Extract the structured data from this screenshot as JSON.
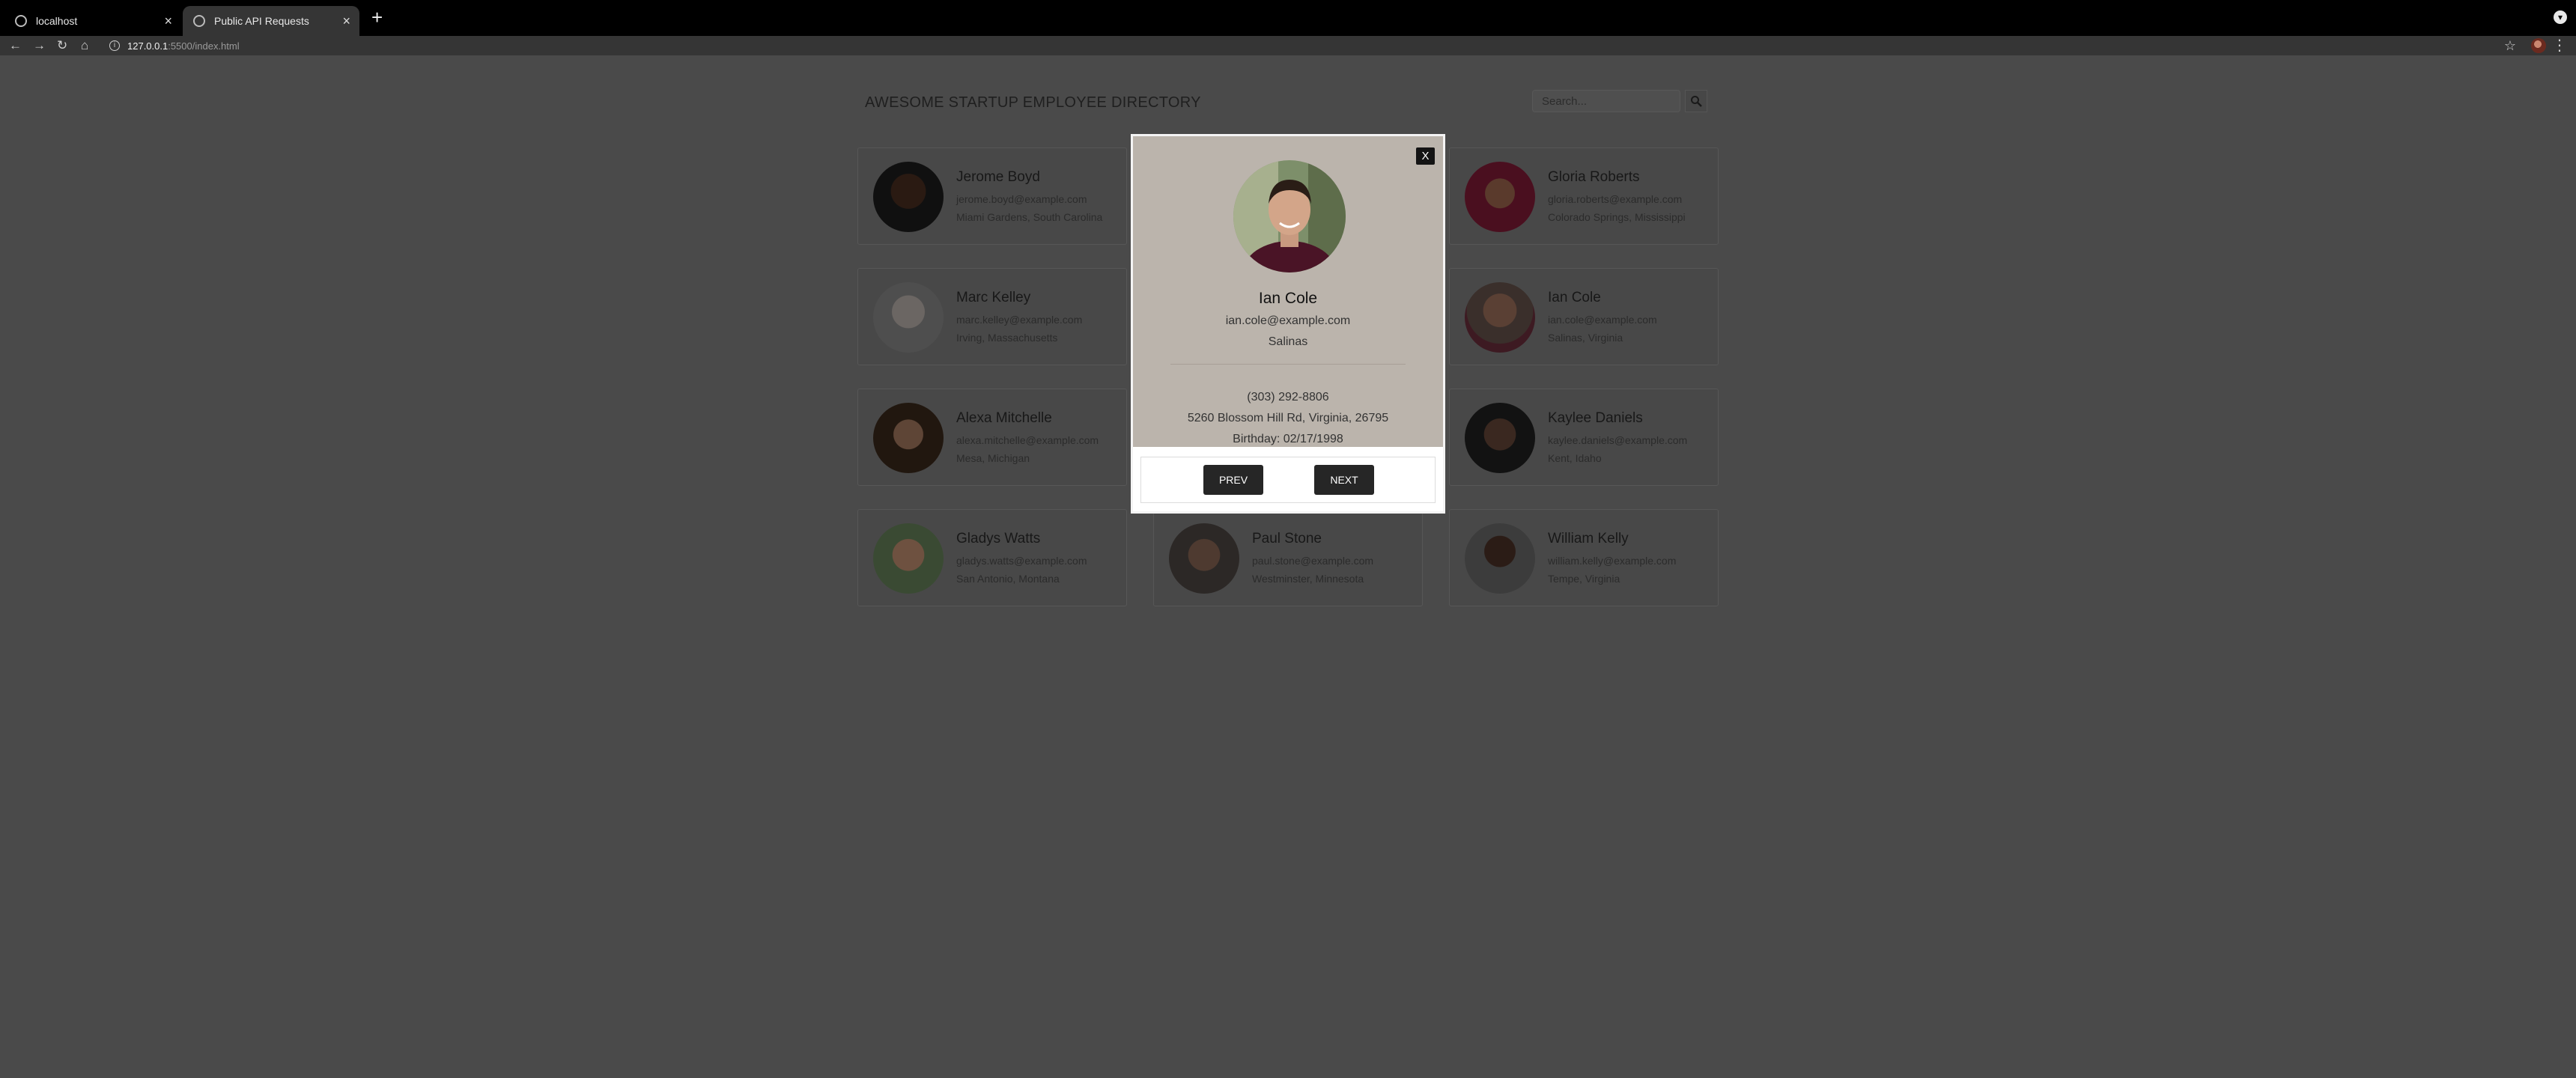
{
  "browser": {
    "tabs": [
      {
        "title": "localhost"
      },
      {
        "title": "Public API Requests"
      }
    ],
    "url_host": "127.0.0.1",
    "url_path": ":5500/index.html"
  },
  "page": {
    "title": "AWESOME STARTUP EMPLOYEE DIRECTORY",
    "search_placeholder": "Search..."
  },
  "employees": [
    {
      "name": "Jerome Boyd",
      "email": "jerome.boyd@example.com",
      "location": "Miami Gardens, South Carolina"
    },
    {
      "name": "Gloria Roberts",
      "email": "gloria.roberts@example.com",
      "location": "Colorado Springs, Mississippi"
    },
    {
      "name": "Marc Kelley",
      "email": "marc.kelley@example.com",
      "location": "Irving, Massachusetts"
    },
    {
      "name": "Ian Cole",
      "email": "ian.cole@example.com",
      "location": "Salinas, Virginia"
    },
    {
      "name": "Alexa Mitchelle",
      "email": "alexa.mitchelle@example.com",
      "location": "Mesa, Michigan"
    },
    {
      "name": "Kaylee Daniels",
      "email": "kaylee.daniels@example.com",
      "location": "Kent, Idaho"
    },
    {
      "name": "Gladys Watts",
      "email": "gladys.watts@example.com",
      "location": "San Antonio, Montana"
    },
    {
      "name": "Paul Stone",
      "email": "paul.stone@example.com",
      "location": "Westminster, Minnesota"
    },
    {
      "name": "William Kelly",
      "email": "william.kelly@example.com",
      "location": "Tempe, Virginia"
    }
  ],
  "modal": {
    "close_label": "X",
    "name": "Ian Cole",
    "email": "ian.cole@example.com",
    "city": "Salinas",
    "phone": "(303) 292-8806",
    "address": "5260 Blossom Hill Rd, Virginia, 26795",
    "birthday": "Birthday: 02/17/1998",
    "prev_label": "PREV",
    "next_label": "NEXT"
  }
}
